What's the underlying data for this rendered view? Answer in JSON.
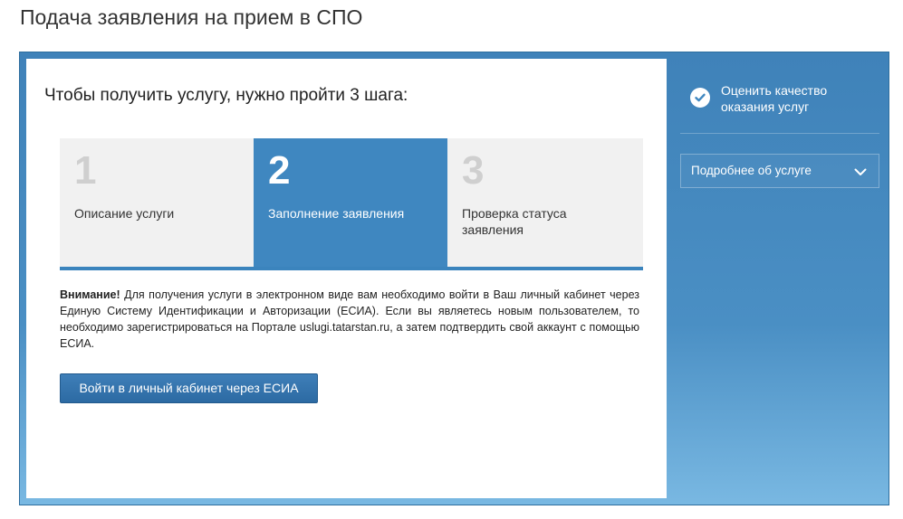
{
  "page": {
    "title": "Подача заявления на прием в СПО"
  },
  "main": {
    "heading": "Чтобы получить услугу, нужно пройти 3 шага:",
    "steps": [
      {
        "number": "1",
        "label": "Описание услуги",
        "active": false
      },
      {
        "number": "2",
        "label": "Заполнение заявления",
        "active": true
      },
      {
        "number": "3",
        "label": "Проверка статуса заявления",
        "active": false
      }
    ],
    "notice": {
      "strong": "Внимание!",
      "text": " Для получения услуги в электронном виде вам необходимо войти в Ваш личный кабинет через Единую Систему Идентификации и Авторизации (ЕСИА). Если вы являетесь новым пользователем, то необходимо зарегистрироваться на Портале uslugi.tatarstan.ru, а затем подтвердить свой аккаунт с помощью ЕСИА."
    },
    "esia_button": "Войти в личный кабинет через ЕСИА"
  },
  "sidebar": {
    "rate_label": "Оценить качество оказания услуг",
    "details_label": "Подробнее об услуге"
  },
  "colors": {
    "accent": "#3f87c0",
    "frame": "#4a8fc4",
    "step_inactive_bg": "#f1f1f1"
  },
  "icons": {
    "rate": "check-circle-icon",
    "details": "chevron-down-icon"
  }
}
